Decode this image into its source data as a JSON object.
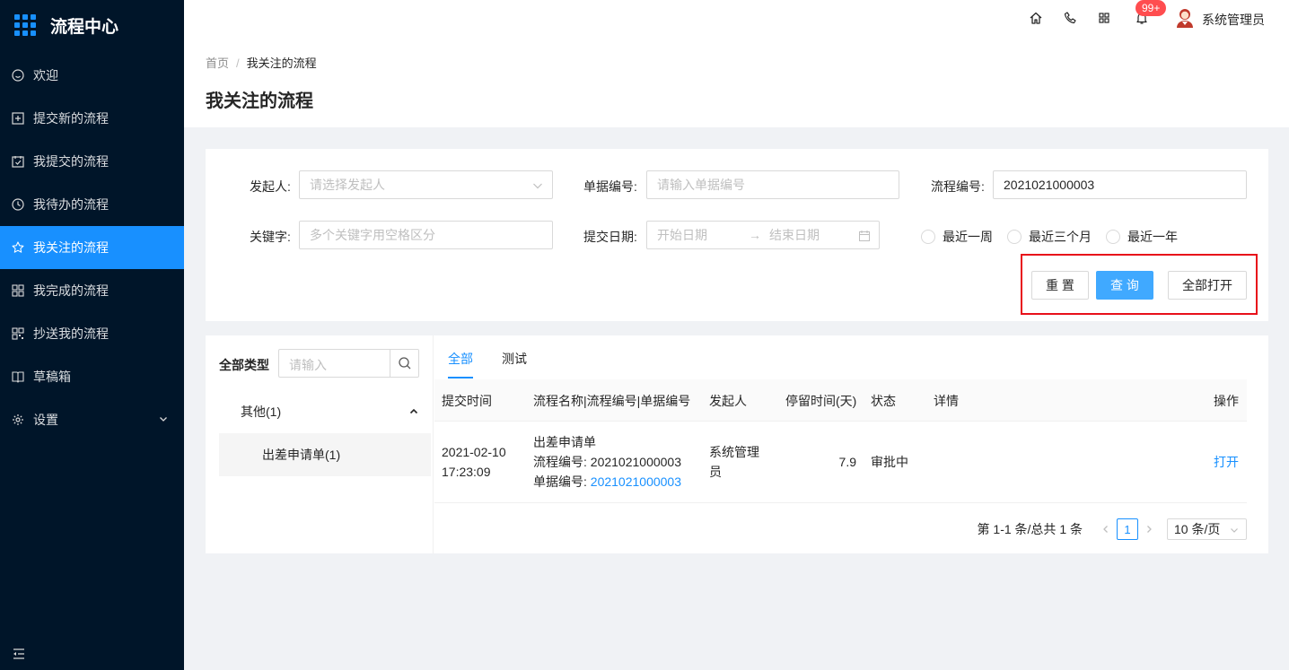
{
  "app": {
    "title": "流程中心"
  },
  "sidebar": {
    "items": [
      {
        "label": "欢迎",
        "icon": "smile-icon"
      },
      {
        "label": "提交新的流程",
        "icon": "plus-square-icon"
      },
      {
        "label": "我提交的流程",
        "icon": "calendar-check-icon"
      },
      {
        "label": "我待办的流程",
        "icon": "clock-icon"
      },
      {
        "label": "我关注的流程",
        "icon": "star-icon",
        "active": true
      },
      {
        "label": "我完成的流程",
        "icon": "appstore-icon"
      },
      {
        "label": "抄送我的流程",
        "icon": "copy-grid-icon"
      },
      {
        "label": "草稿箱",
        "icon": "book-icon"
      },
      {
        "label": "设置",
        "icon": "gear-icon",
        "expandable": true
      }
    ]
  },
  "header": {
    "notification_badge": "99+",
    "username": "系统管理员"
  },
  "breadcrumb": {
    "home": "首页",
    "separator": "/",
    "current": "我关注的流程"
  },
  "page": {
    "title": "我关注的流程"
  },
  "filters": {
    "initiator": {
      "label": "发起人:",
      "placeholder": "请选择发起人"
    },
    "doc_no": {
      "label": "单据编号:",
      "placeholder": "请输入单据编号"
    },
    "flow_no": {
      "label": "流程编号:",
      "value": "2021021000003"
    },
    "keyword": {
      "label": "关键字:",
      "placeholder": "多个关键字用空格区分"
    },
    "date": {
      "label": "提交日期:",
      "start_placeholder": "开始日期",
      "arrow": "→",
      "end_placeholder": "结束日期"
    },
    "quick_ranges": [
      "最近一周",
      "最近三个月",
      "最近一年"
    ]
  },
  "actions": {
    "reset": "重 置",
    "query": "查 询",
    "open_all": "全部打开"
  },
  "tree": {
    "title": "全部类型",
    "search_placeholder": "请输入",
    "node": "其他(1)",
    "child": "出差申请单(1)"
  },
  "tabs": [
    "全部",
    "测试"
  ],
  "table": {
    "columns": [
      "提交时间",
      "流程名称|流程编号|单据编号",
      "发起人",
      "停留时间(天)",
      "状态",
      "详情",
      "操作"
    ],
    "rows": [
      {
        "submit_date": "2021-02-10",
        "submit_time": "17:23:09",
        "flow_name": "出差申请单",
        "flow_no_text": "流程编号: 2021021000003",
        "doc_no_label": "单据编号: ",
        "doc_no": "2021021000003",
        "initiator_line1": "系统管理",
        "initiator_line2": "员",
        "stay_days": "7.9",
        "status": "审批中",
        "detail": "",
        "action": "打开"
      }
    ]
  },
  "pagination": {
    "total_text": "第 1-1 条/总共 1 条",
    "current_page": "1",
    "page_size": "10 条/页"
  },
  "colors": {
    "sidebar_bg": "#001529",
    "accent": "#1890ff",
    "highlight_border": "#e8101a",
    "badge": "#ff4d4f"
  }
}
